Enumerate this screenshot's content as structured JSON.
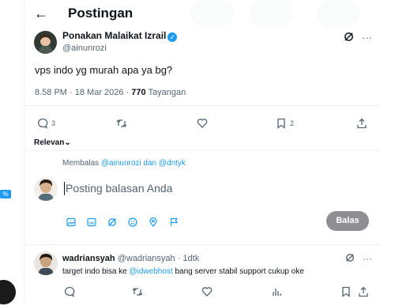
{
  "header": {
    "title": "Postingan"
  },
  "post": {
    "author_name": "Ponakan Malaikat Izrail",
    "author_handle": "@ainunrozi",
    "text": "vps indo yg murah apa ya bg?",
    "timestamp": "8.58 PM · 18 Mar 2026 · ",
    "views_count": "770",
    "views_label": " Tayangan",
    "actions": {
      "replies": "3",
      "reposts": "",
      "likes": "",
      "bookmarks": "2"
    }
  },
  "sort": {
    "label": "Relevan",
    "icon": "chevron-down-icon"
  },
  "compose": {
    "reply_to_prefix": "Membalas ",
    "reply_to_mentions": "@ainunrozi dan @dntyk",
    "placeholder": "Posting balasan Anda",
    "tools": [
      "image-icon",
      "gif-icon",
      "grok-icon",
      "emoji-icon",
      "location-icon",
      "flag-icon"
    ],
    "submit_label": "Balas"
  },
  "reply": {
    "name": "wadriansyah",
    "handle": "@wadriansyah",
    "time": " · 1dtk",
    "text_before": "target indo bisa ke ",
    "link": "@idwebhost",
    "text_after": " bang server stabil support cukup oke"
  },
  "side": {
    "badge": "%"
  },
  "colors": {
    "accent": "#1d9bf0",
    "text": "#0f1419",
    "muted": "#536471",
    "border": "#eff3f4"
  }
}
